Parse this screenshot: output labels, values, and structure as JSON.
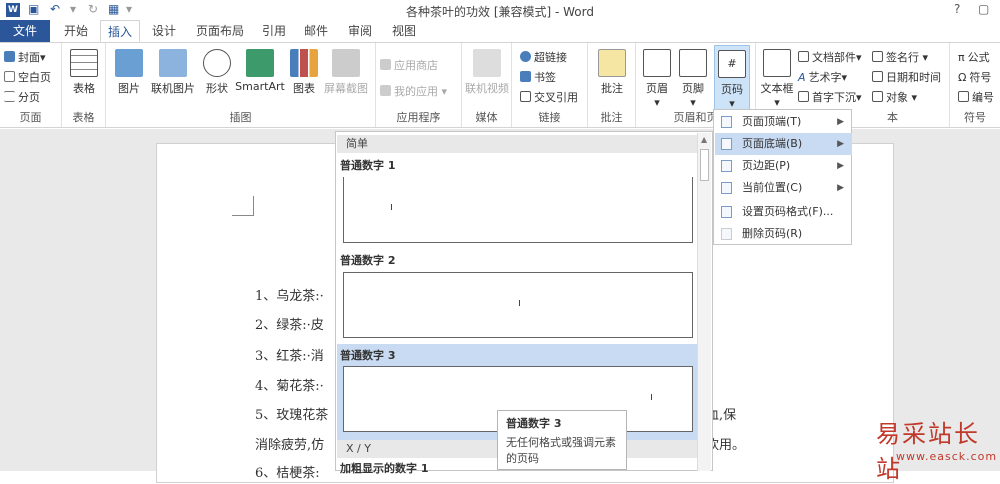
{
  "titlebar": {
    "app_icon": "W",
    "title": "各种茶叶的功效 [兼容模式] - Word",
    "help": "?",
    "restore": "▢",
    "close": "✕"
  },
  "tabs": [
    "文件",
    "开始",
    "插入",
    "设计",
    "页面布局",
    "引用",
    "邮件",
    "审阅",
    "视图"
  ],
  "ribbon": {
    "pages": {
      "cover": "封面",
      "blank": "空白页",
      "break": "分页",
      "label": "页面"
    },
    "tables": {
      "table": "表格",
      "label": "表格"
    },
    "illustrations": {
      "picture": "图片",
      "online_picture": "联机图片",
      "shapes": "形状",
      "smartart": "SmartArt",
      "chart": "图表",
      "screenshot": "屏幕截图",
      "label": "插图"
    },
    "apps": {
      "store": "应用商店",
      "my_apps": "我的应用",
      "label": "应用程序"
    },
    "media": {
      "video": "联机视频",
      "label": "媒体"
    },
    "links": {
      "hyperlink": "超链接",
      "bookmark": "书签",
      "crossref": "交叉引用",
      "label": "链接"
    },
    "comments": {
      "comment": "批注",
      "label": "批注"
    },
    "header_footer": {
      "header": "页眉",
      "footer": "页脚",
      "page_number": "页码",
      "label": "页眉和页"
    },
    "text": {
      "textbox": "文本框",
      "quick_parts": "文档部件",
      "wordart": "艺术字",
      "dropcap": "首字下沉",
      "signature": "签名行",
      "datetime": "日期和时间",
      "object": "对象",
      "label": "本"
    },
    "symbols": {
      "equation": "公式",
      "symbol": "符号",
      "number": "编号",
      "label": "符号"
    }
  },
  "document": {
    "lines": [
      "1、乌龙茶:·",
      "2、绿茶:·皮",
      "3、红茶:·消",
      "4、菊花茶:·",
      "5、玫瑰花茶",
      "消除疲劳,仿",
      "6、桔梗茶:"
    ],
    "tail1": "血,保",
    "tail2": "饮用。"
  },
  "gallery": {
    "section1": "简单",
    "items": [
      "普通数字 1",
      "普通数字 2",
      "普通数字 3"
    ],
    "section2": "X / Y",
    "item4": "加粗显示的数字 1"
  },
  "tooltip": {
    "title": "普通数字 3",
    "desc": "无任何格式或强调元素的页码"
  },
  "menu": {
    "items": [
      "页面顶端(T)",
      "页面底端(B)",
      "页边距(P)",
      "当前位置(C)",
      "设置页码格式(F)...",
      "删除页码(R)"
    ]
  },
  "watermark": {
    "main": "易采站长站",
    "sub": "www.easck.com"
  }
}
